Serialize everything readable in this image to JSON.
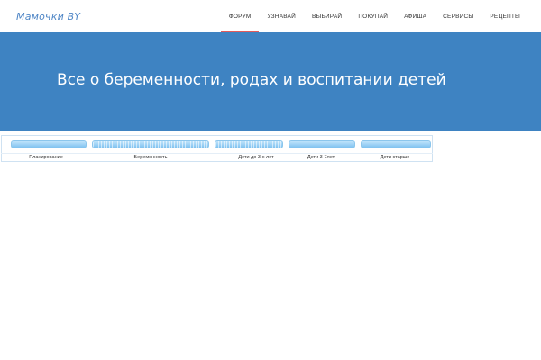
{
  "header": {
    "logo": "Мамочки BY",
    "nav": [
      {
        "label": "ФОРУМ",
        "active": true
      },
      {
        "label": "УЗНАВАЙ"
      },
      {
        "label": "ВЫБИРАЙ"
      },
      {
        "label": "ПОКУПАЙ"
      },
      {
        "label": "АФИША"
      },
      {
        "label": "СЕРВИСЫ"
      },
      {
        "label": "РЕЦЕПТЫ"
      }
    ]
  },
  "hero": {
    "title": "Все о беременности, родах и воспитании детей"
  },
  "categories": [
    {
      "label": "Планирование"
    },
    {
      "label": "Беременность"
    },
    {
      "label": "Дети до 3-х лет"
    },
    {
      "label": "Дети 3-7лет"
    },
    {
      "label": "Дети старше"
    }
  ],
  "colors": {
    "hero_bg": "#3e83c2",
    "logo": "#4f86c6",
    "active_nav_underline": "#e35b5b",
    "category_bar": "#7fc2f0"
  }
}
